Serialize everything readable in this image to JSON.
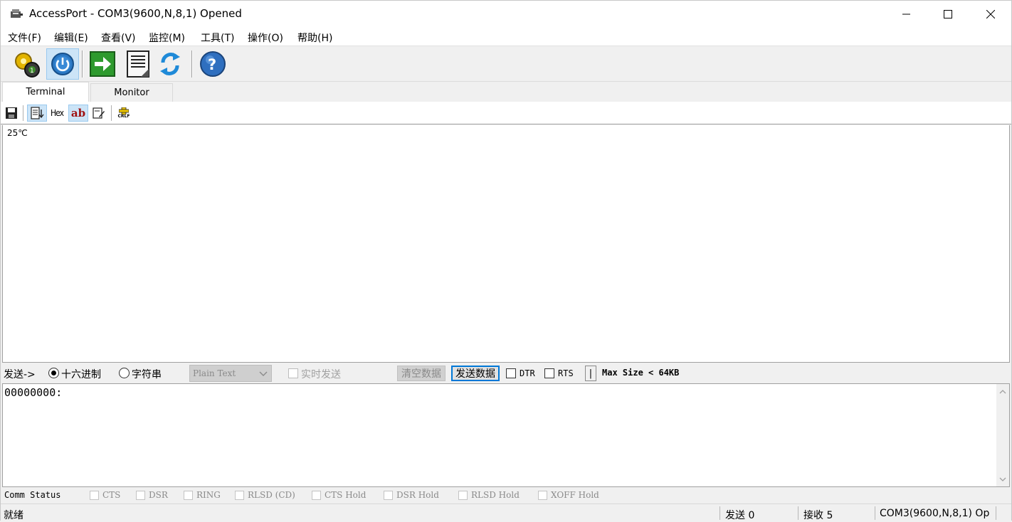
{
  "window": {
    "title": "AccessPort - COM3(9600,N,8,1) Opened"
  },
  "menu": {
    "items": [
      "文件(F)",
      "编辑(E)",
      "查看(V)",
      "监控(M)",
      "工具(T)",
      "操作(O)",
      "帮助(H)"
    ]
  },
  "toolbar": {
    "buttons": [
      {
        "icon": "settings-gear-icon"
      },
      {
        "icon": "power-icon",
        "active": true
      },
      {
        "icon": "green-arrow-icon"
      },
      {
        "icon": "document-icon"
      },
      {
        "icon": "refresh-arrows-icon"
      },
      {
        "icon": "help-icon"
      }
    ]
  },
  "tabs": [
    {
      "label": "Terminal",
      "selected": true
    },
    {
      "label": "Monitor",
      "selected": false
    }
  ],
  "subtoolbar": {
    "hex_label": "Hex",
    "ab_label": "ab",
    "crlf_label": "CRLF"
  },
  "terminal": {
    "content": "25℃"
  },
  "sendbar": {
    "send_label": "发送->",
    "hex_radio_label": "十六进制",
    "string_radio_label": "字符串",
    "format_select": "Plain Text",
    "realtime_label": "实时发送",
    "clear_button": "清空数据",
    "send_button": "发送数据",
    "dtr_label": "DTR",
    "rts_label": "RTS",
    "pipe_label": "|",
    "max_size": "Max Size < 64KB"
  },
  "hexeditor": {
    "content": "00000000:"
  },
  "comm_status": {
    "title": "Comm Status",
    "items": [
      "CTS",
      "DSR",
      "RING",
      "RLSD (CD)",
      "CTS Hold",
      "DSR Hold",
      "RLSD Hold",
      "XOFF Hold"
    ]
  },
  "statusbar": {
    "ready": "就绪",
    "sent": "发送 0",
    "received": "接收 5",
    "port": "COM3(9600,N,8,1) Op"
  },
  "colors": {
    "accent": "#0078d7",
    "active_bg": "#cce4f7"
  }
}
